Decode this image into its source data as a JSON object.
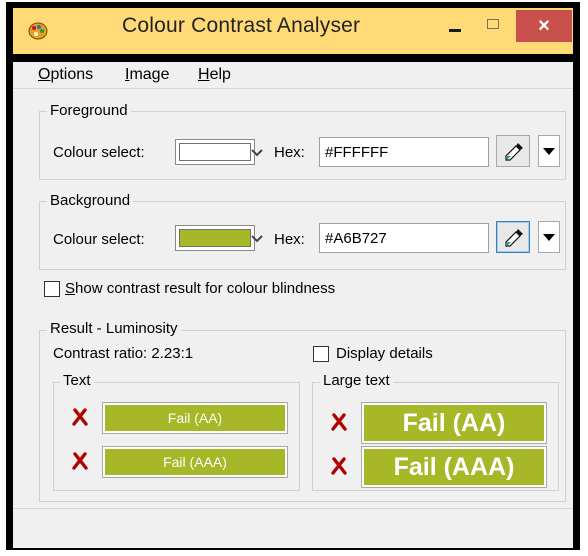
{
  "window": {
    "title": "Colour Contrast Analyser",
    "close_glyph": "×",
    "icons": {
      "app": "palette-icon",
      "minimize": "minimize-icon",
      "maximize": "maximize-icon",
      "close": "close-icon"
    }
  },
  "menu": {
    "items": [
      {
        "accel": "O",
        "rest": "ptions"
      },
      {
        "accel": "I",
        "rest": "mage"
      },
      {
        "accel": "H",
        "rest": "elp"
      }
    ]
  },
  "foreground": {
    "title": "Foreground",
    "colour_label": "Colour select:",
    "swatch_color": "#FFFFFF",
    "hex_label": "Hex:",
    "hex_value": "#FFFFFF"
  },
  "background": {
    "title": "Background",
    "colour_label": "Colour select:",
    "swatch_color": "#A6B727",
    "hex_label": "Hex:",
    "hex_value": "#A6B727"
  },
  "blindness": {
    "accel": "S",
    "rest": "how contrast result for colour blindness",
    "checked": false
  },
  "result": {
    "title": "Result - Luminosity",
    "contrast_ratio": "Contrast ratio: 2.23:1",
    "display_details": "Display details",
    "text_group": {
      "title": "Text",
      "aa": "Fail (AA)",
      "aaa": "Fail (AAA)"
    },
    "large_group": {
      "title": "Large text",
      "aa": "Fail (AA)",
      "aaa": "Fail (AAA)"
    }
  },
  "colors": {
    "titlebar": "#FFDA77",
    "close_button": "#C7504D",
    "fail_fill": "#A6B727",
    "fail_mark": "#B00000"
  }
}
